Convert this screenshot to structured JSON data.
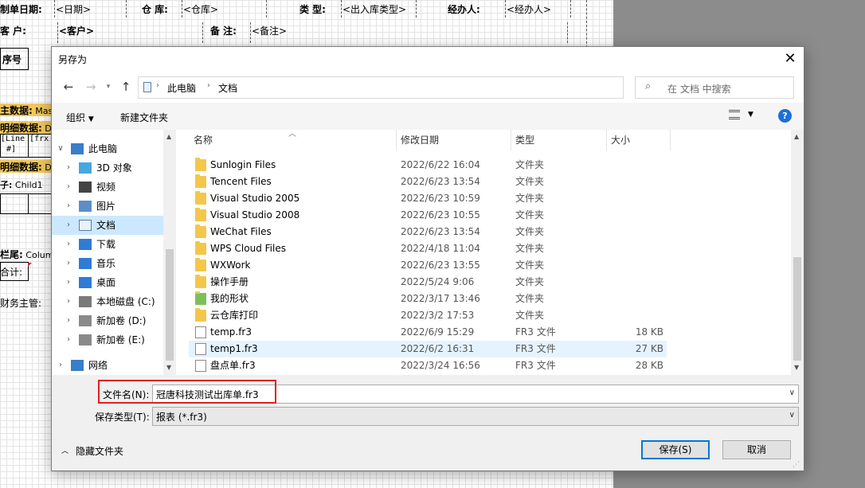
{
  "designer": {
    "row1": {
      "f1_label": "制单日期:",
      "f1_value": "<日期>",
      "f2_label": "仓    库:",
      "f2_value": "<仓库>",
      "f3_label": "类    型:",
      "f3_value": "<出入库类型>",
      "f4_label": "经办人:",
      "f4_value": "<经办人>"
    },
    "row2": {
      "f1_label": "客    户:",
      "f1_value": "<客户>",
      "f2_label": "备    注:",
      "f2_value": "<备注>"
    },
    "seq_header": "序号",
    "band_master_bold": "主数据:",
    "band_master_rest": " Mas",
    "band_detail1_bold": "明细数据:",
    "band_detail1_rest": " D",
    "cell_text": "[Line [frx",
    "cell_text2": "#]",
    "band_detail2_bold": "明细数据:",
    "band_detail2_rest": " D",
    "child_label_bold": "子:",
    "child_label_rest": " Child1",
    "footer_bold": "栏尾:",
    "footer_rest": " Colum",
    "total_label": "合计:",
    "finance_label": "财务主管:"
  },
  "dialog": {
    "title": "另存为",
    "close_glyph": "✕",
    "breadcrumb": [
      "此电脑",
      "文档"
    ],
    "search_placeholder": "在 文档 中搜索",
    "toolbar": {
      "organize": "组织",
      "new_folder": "新建文件夹"
    },
    "tree": [
      {
        "label": "此电脑",
        "icon": "pc-icon",
        "expanded": true
      },
      {
        "label": "3D 对象",
        "icon": "3d-objects-icon"
      },
      {
        "label": "视频",
        "icon": "video-icon"
      },
      {
        "label": "图片",
        "icon": "pictures-icon"
      },
      {
        "label": "文档",
        "icon": "documents-icon",
        "selected": true
      },
      {
        "label": "下载",
        "icon": "download-icon"
      },
      {
        "label": "音乐",
        "icon": "music-icon"
      },
      {
        "label": "桌面",
        "icon": "desktop-icon"
      },
      {
        "label": "本地磁盘 (C:)",
        "icon": "drive-c-icon"
      },
      {
        "label": "新加卷 (D:)",
        "icon": "drive-icon"
      },
      {
        "label": "新加卷 (E:)",
        "icon": "drive-icon"
      },
      {
        "label": "网络",
        "icon": "network-icon"
      }
    ],
    "columns": {
      "name": "名称",
      "date": "修改日期",
      "type": "类型",
      "size": "大小"
    },
    "files": [
      {
        "name": "Sunlogin Files",
        "date": "2022/6/22 16:04",
        "type": "文件夹",
        "size": "",
        "kind": "folder"
      },
      {
        "name": "Tencent Files",
        "date": "2022/6/23 13:54",
        "type": "文件夹",
        "size": "",
        "kind": "folder"
      },
      {
        "name": "Visual Studio 2005",
        "date": "2022/6/23 10:59",
        "type": "文件夹",
        "size": "",
        "kind": "folder"
      },
      {
        "name": "Visual Studio 2008",
        "date": "2022/6/23 10:55",
        "type": "文件夹",
        "size": "",
        "kind": "folder"
      },
      {
        "name": "WeChat Files",
        "date": "2022/6/23 13:54",
        "type": "文件夹",
        "size": "",
        "kind": "folder"
      },
      {
        "name": "WPS Cloud Files",
        "date": "2022/4/18 11:04",
        "type": "文件夹",
        "size": "",
        "kind": "folder"
      },
      {
        "name": "WXWork",
        "date": "2022/6/23 13:55",
        "type": "文件夹",
        "size": "",
        "kind": "folder"
      },
      {
        "name": "操作手册",
        "date": "2022/5/24 9:06",
        "type": "文件夹",
        "size": "",
        "kind": "folder"
      },
      {
        "name": "我的形状",
        "date": "2022/3/17 13:46",
        "type": "文件夹",
        "size": "",
        "kind": "shapes"
      },
      {
        "name": "云仓库打印",
        "date": "2022/3/2 17:53",
        "type": "文件夹",
        "size": "",
        "kind": "folder"
      },
      {
        "name": "temp.fr3",
        "date": "2022/6/9 15:29",
        "type": "FR3 文件",
        "size": "18 KB",
        "kind": "file"
      },
      {
        "name": "temp1.fr3",
        "date": "2022/6/2 16:31",
        "type": "FR3 文件",
        "size": "27 KB",
        "kind": "file",
        "selected": true
      },
      {
        "name": "盘点单.fr3",
        "date": "2022/3/24 16:56",
        "type": "FR3 文件",
        "size": "28 KB",
        "kind": "file"
      }
    ],
    "filename_label": "文件名(N):",
    "filename_value": "冠唐科技测试出库单.fr3",
    "filetype_label": "保存类型(T):",
    "filetype_value": "报表 (*.fr3)",
    "hide_folders": "隐藏文件夹",
    "save_button": "保存(S)",
    "cancel_button": "取消",
    "accent_color": "#0078d7",
    "highlight_color": "#e0201b"
  }
}
